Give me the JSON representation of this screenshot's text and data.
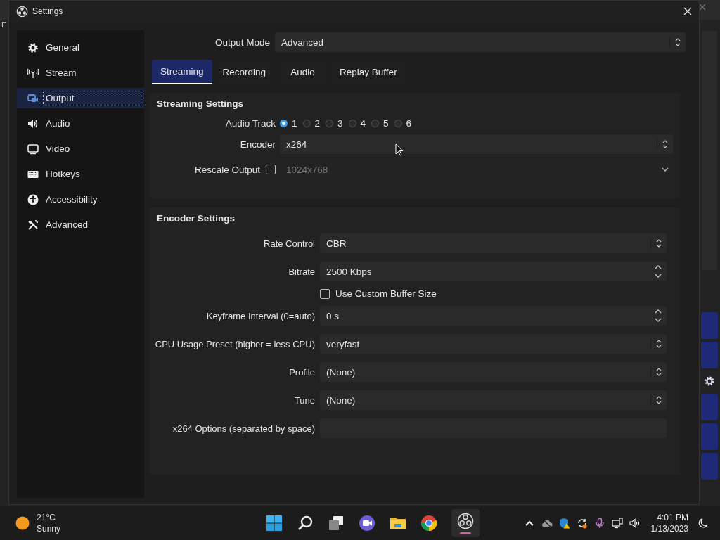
{
  "background_app": {
    "menu_letter": "F"
  },
  "window": {
    "title": "Settings"
  },
  "sidebar": {
    "items": [
      {
        "label": "General",
        "selected": false
      },
      {
        "label": "Stream",
        "selected": false
      },
      {
        "label": "Output",
        "selected": true
      },
      {
        "label": "Audio",
        "selected": false
      },
      {
        "label": "Video",
        "selected": false
      },
      {
        "label": "Hotkeys",
        "selected": false
      },
      {
        "label": "Accessibility",
        "selected": false
      },
      {
        "label": "Advanced",
        "selected": false
      }
    ]
  },
  "output_mode": {
    "label": "Output Mode",
    "value": "Advanced"
  },
  "tabs": [
    {
      "label": "Streaming",
      "selected": true
    },
    {
      "label": "Recording",
      "selected": false
    },
    {
      "label": "Audio",
      "selected": false
    },
    {
      "label": "Replay Buffer",
      "selected": false
    }
  ],
  "streaming_settings": {
    "title": "Streaming Settings",
    "audio_track": {
      "label": "Audio Track",
      "options": [
        {
          "label": "1",
          "selected": true
        },
        {
          "label": "2",
          "selected": false
        },
        {
          "label": "3",
          "selected": false
        },
        {
          "label": "4",
          "selected": false
        },
        {
          "label": "5",
          "selected": false
        },
        {
          "label": "6",
          "selected": false
        }
      ]
    },
    "encoder": {
      "label": "Encoder",
      "value": "x264"
    },
    "rescale_output": {
      "label": "Rescale Output",
      "checked": false,
      "value": "1024x768",
      "disabled": true
    }
  },
  "encoder_settings": {
    "title": "Encoder Settings",
    "rows": [
      {
        "kind": "select",
        "label": "Rate Control",
        "value": "CBR"
      },
      {
        "kind": "spin",
        "label": "Bitrate",
        "value": "2500 Kbps"
      },
      {
        "kind": "checkbox",
        "label": "Use Custom Buffer Size",
        "checked": false
      },
      {
        "kind": "spin",
        "label": "Keyframe Interval (0=auto)",
        "value": "0 s"
      },
      {
        "kind": "select",
        "label": "CPU Usage Preset (higher = less CPU)",
        "value": "veryfast"
      },
      {
        "kind": "select",
        "label": "Profile",
        "value": "(None)"
      },
      {
        "kind": "select",
        "label": "Tune",
        "value": "(None)"
      },
      {
        "kind": "text",
        "label": "x264 Options (separated by space)"
      }
    ]
  },
  "taskbar": {
    "weather": {
      "temperature": "21°C",
      "condition": "Sunny"
    },
    "clock": {
      "time": "4:01 PM",
      "date": "1/13/2023"
    }
  }
}
